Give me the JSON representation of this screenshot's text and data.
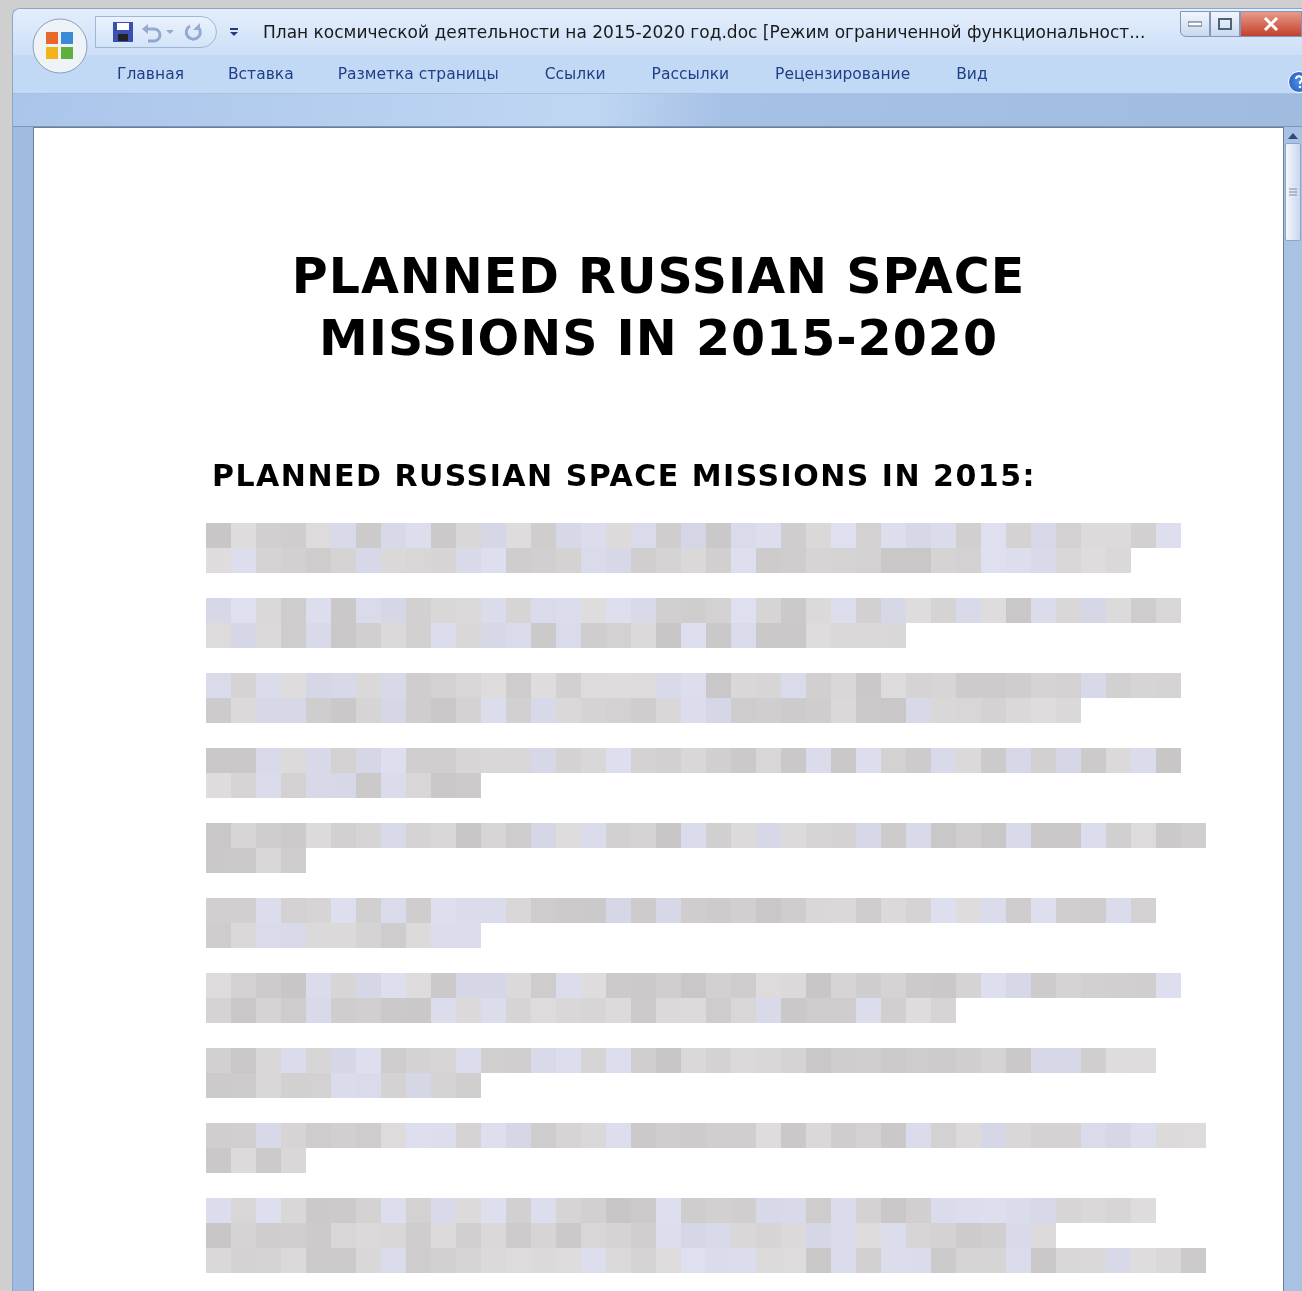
{
  "window": {
    "title": "План космической деятельности на 2015-2020 год.doc [Режим ограниченной функциональност..."
  },
  "quick_access": {
    "undo_disabled": true,
    "redo_disabled": true
  },
  "tabs": [
    {
      "label": "Главная",
      "selected": false
    },
    {
      "label": "Вставка",
      "selected": false
    },
    {
      "label": "Разметка страницы",
      "selected": false
    },
    {
      "label": "Ссылки",
      "selected": false
    },
    {
      "label": "Рассылки",
      "selected": false
    },
    {
      "label": "Рецензирование",
      "selected": false
    },
    {
      "label": "Вид",
      "selected": false
    }
  ],
  "document": {
    "title": [
      "PLANNED RUSSIAN SPACE",
      "MISSIONS IN 2015-2020"
    ],
    "heading": "PLANNED RUSSIAN SPACE MISSIONS IN 2015:",
    "paragraphs": [
      {
        "kind": "pixelated"
      },
      {
        "kind": "pixelated"
      },
      {
        "kind": "pixelated"
      },
      {
        "kind": "pixelated"
      },
      {
        "kind": "pixelated"
      },
      {
        "kind": "pixelated"
      },
      {
        "kind": "pixelated"
      },
      {
        "kind": "pixelated"
      },
      {
        "kind": "pixelated"
      },
      {
        "kind": "pixelated"
      }
    ]
  }
}
